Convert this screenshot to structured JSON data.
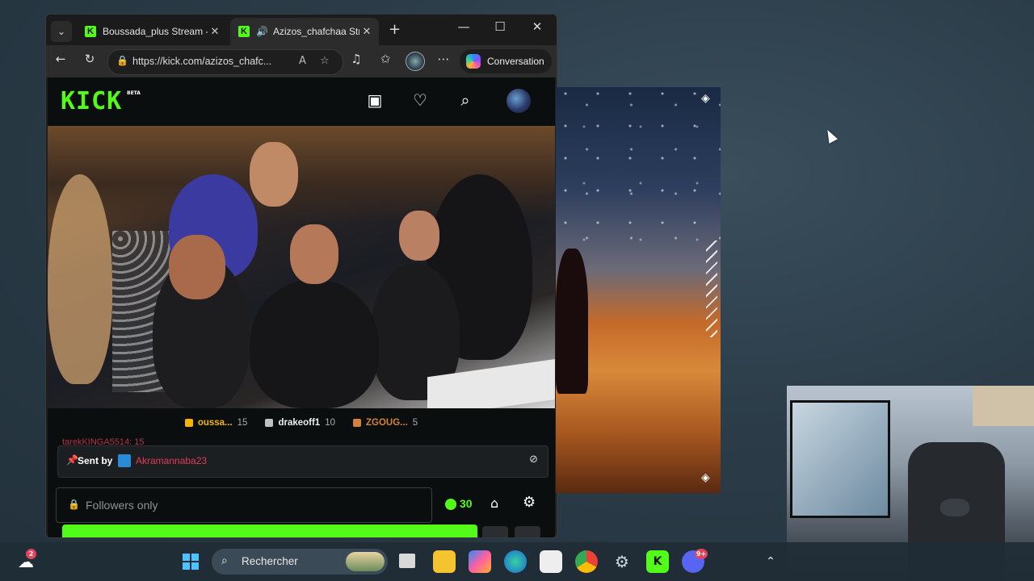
{
  "browser": {
    "tabs": [
      {
        "title": "Boussada_plus Stream - ..."
      },
      {
        "title": "Azizos_chafchaa Stream"
      }
    ],
    "url": "https://kick.com/azizos_chafc...",
    "conversation_label": "Conversation"
  },
  "kick": {
    "logo": "KICK",
    "beta": "BETA",
    "leaderboard": [
      {
        "name": "oussa...",
        "value": "15",
        "color": "#f4b400"
      },
      {
        "name": "drakeoff1",
        "value": "10",
        "color": "#c0c0c0"
      },
      {
        "name": "ZGOUG...",
        "value": "5",
        "color": "#d4823a"
      }
    ],
    "partial_chat_line": "tarekKINGA5514: 15",
    "pinned": {
      "sent_by": "Sent by",
      "user": "Akramannaba23"
    },
    "chat_placeholder": "Followers only",
    "points": "30"
  },
  "taskbar": {
    "search_label": "Rechercher",
    "weather_badge": "2",
    "discord_badge": "9+"
  },
  "icons": {
    "tab_menu": "chevron-down-icon",
    "back": "arrow-left-icon",
    "refresh": "refresh-icon",
    "lock": "lock-icon",
    "heart": "heart-icon",
    "search": "search-icon",
    "gear": "gear-icon"
  },
  "colors": {
    "kick_green": "#53fc18",
    "chat_red": "#e23a5a"
  }
}
